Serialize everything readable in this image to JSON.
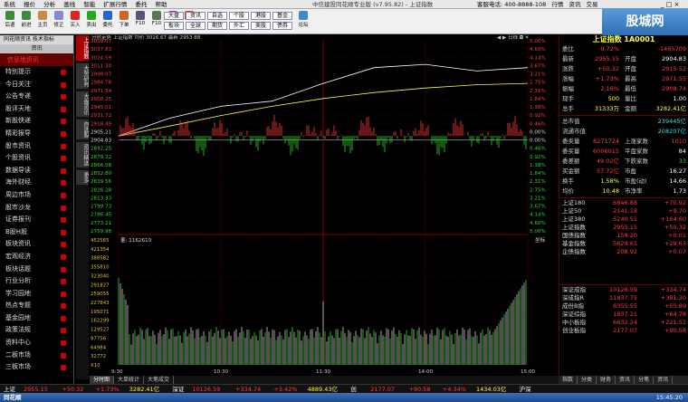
{
  "titlebar": {
    "menus": [
      "系统",
      "报价",
      "分析",
      "画线",
      "智能",
      "扩展行情",
      "委托",
      "帮助"
    ],
    "caption": "中信建投同花顺专业版 (v7.95.82) - 上证指数",
    "right": [
      "客服电话: 400-8888-108",
      "行情",
      "资讯",
      "交易"
    ],
    "window_controls": "_ □ ×"
  },
  "toolbar": {
    "buttons": [
      "后退",
      "前进",
      "主页",
      "修正",
      "买入",
      "卖出",
      "委托",
      "下单",
      "F10",
      "F10",
      "分时",
      "K线"
    ],
    "boxes": [
      "大盘",
      "资讯",
      "自选",
      "个股",
      "板块",
      "全球",
      "期货",
      "外汇",
      "港股",
      "美股",
      "基金",
      "债券"
    ],
    "extra": [
      "论坛"
    ],
    "ad_text": "股城网"
  },
  "sidebar": {
    "tabs": "同花顺资讯  技术指标",
    "subtab": "资讯",
    "heading": "信息地资讯",
    "items": [
      "特别提示",
      "今日关注",
      "公告专递",
      "股评天地",
      "新股快递",
      "精彩报导",
      "股市资讯",
      "个股资讯",
      "数据导读",
      "海外财经",
      "周边市场",
      "股市沙龙",
      "证券报刊",
      "B股H股",
      "板块资讯",
      "宏观经济",
      "板块话题",
      "行业分析",
      "学习园地",
      "热点专题",
      "基金园地",
      "政策法规",
      "资料中心",
      "二板市场",
      "三板市场"
    ],
    "footer": "信息地资讯"
  },
  "vtabs": [
    "上证指数",
    "大势研判",
    "大盘资讯",
    "自选股",
    "资讯精选",
    "更多"
  ],
  "chart": {
    "header": "分时走势  上证指数  均价 3016.67  最新 2953.88",
    "price_labels_left": [
      "3050.07",
      "3037.83",
      "3024.59",
      "3011.30",
      "2998.07",
      "2984.78",
      "2971.54",
      "2958.25",
      "2945.01",
      "2931.72",
      "2918.49",
      "2905.21",
      "2904.83",
      "2892.25",
      "2879.32",
      "2866.08",
      "2852.80",
      "2839.56",
      "2826.28",
      "2813.33",
      "2799.73",
      "2786.45",
      "2773.21",
      "2759.98"
    ],
    "pct_labels_right": [
      "5.00%",
      "4.60%",
      "4.14%",
      "3.67%",
      "3.21%",
      "2.75%",
      "2.31%",
      "1.84%",
      "1.38%",
      "0.92%",
      "0.46%",
      "0.00%",
      "0.00%",
      "0.46%",
      "0.92%",
      "1.38%",
      "1.84%",
      "2.31%",
      "2.75%",
      "3.21%",
      "3.67%",
      "4.14%",
      "4.60%",
      "5.00%"
    ],
    "vol_header": "量: 1162610",
    "vol_labels_left": [
      "452565",
      "421354",
      "388582",
      "355810",
      "323040",
      "291827",
      "259055",
      "227843",
      "195071",
      "162299",
      "129527",
      "97756",
      "64984",
      "32772",
      "X10"
    ],
    "vol_button": "坐标",
    "time_labels": [
      "9:30",
      "10:30",
      "11:30",
      "14:00",
      "15:00"
    ],
    "top_right_icons": "◀ ▶  日线  ◘ ✕"
  },
  "chart_data": {
    "type": "line",
    "x": [
      "9:30",
      "10:00",
      "10:30",
      "11:00",
      "11:30",
      "13:30",
      "14:00",
      "14:30",
      "15:00"
    ],
    "series": [
      {
        "name": "最新",
        "values": [
          2904.83,
          2932,
          2950,
          2958,
          2985,
          3009,
          3014,
          3004,
          3009
        ]
      },
      {
        "name": "均价",
        "values": [
          2904.83,
          2920,
          2936,
          2950,
          2962,
          2971,
          2978,
          2983,
          2985
        ]
      }
    ],
    "ylim": [
      2759.98,
      3050.07
    ]
  },
  "rpanel": {
    "title": "上证指数 1A0001",
    "rows": [
      {
        "l1": "委比",
        "v1": "-9.72%",
        "c1": "red",
        "l2": "",
        "v2": "-1465709",
        "c2": "red"
      },
      {
        "l1": "最新",
        "v1": "2955.15",
        "c1": "red",
        "l2": "开盘",
        "v2": "2904.83",
        "c2": "wht"
      },
      {
        "l1": "涨跌",
        "v1": "+50.32",
        "c1": "red",
        "l2": "开盘",
        "v2": "2915.52",
        "c2": "red"
      },
      {
        "l1": "涨幅",
        "v1": "+1.73%",
        "c1": "red",
        "l2": "最高",
        "v2": "2971.55",
        "c2": "red"
      },
      {
        "l1": "振幅",
        "v1": "2.16%",
        "c1": "red",
        "l2": "最低",
        "v2": "2908.74",
        "c2": "red"
      },
      {
        "l1": "现手",
        "v1": "500",
        "c1": "yel",
        "l2": "量比",
        "v2": "1.00",
        "c2": "wht"
      },
      {
        "l1": "总手",
        "v1": "31333万",
        "c1": "yel",
        "l2": "金额",
        "v2": "3282.41亿",
        "c2": "yel"
      }
    ],
    "rows2": [
      {
        "l1": "总市值",
        "v1": "",
        "c1": "wht",
        "l2": "",
        "v2": "239445亿",
        "c2": "cyn"
      },
      {
        "l1": "流通市值",
        "v1": "",
        "c1": "wht",
        "l2": "",
        "v2": "208207亿",
        "c2": "cyn"
      },
      {
        "l1": "委卖量",
        "v1": "8271724",
        "c1": "red",
        "l2": "上涨家数",
        "v2": "1010",
        "c2": "red"
      },
      {
        "l1": "委买量",
        "v1": "6006015",
        "c1": "red",
        "l2": "平盘家数",
        "v2": "84",
        "c2": "wht"
      },
      {
        "l1": "委差额",
        "v1": "49.02亿",
        "c1": "red",
        "l2": "下跌家数",
        "v2": "33",
        "c2": "grn"
      },
      {
        "l1": "买金额",
        "v1": "57.72亿",
        "c1": "red",
        "l2": "市盈",
        "v2": "16.27",
        "c2": "wht"
      },
      {
        "l1": "换手",
        "v1": "1.58%",
        "c1": "yel",
        "l2": "市盈(动)",
        "v2": "14.66",
        "c2": "wht"
      },
      {
        "l1": "均价",
        "v1": "10.48",
        "c1": "yel",
        "l2": "市净率",
        "v2": "1.73",
        "c2": "wht"
      }
    ],
    "indices1": [
      {
        "n": "上证180",
        "a": "6846.88",
        "b": "+70.92"
      },
      {
        "n": "上证50",
        "a": "2141.18",
        "b": "+9.70"
      },
      {
        "n": "上证380",
        "a": "5240.51",
        "b": "+164.60"
      },
      {
        "n": "上证指数",
        "a": "2955.15",
        "b": "+50.32"
      },
      {
        "n": "国债指数",
        "a": "158.20",
        "b": "+0.01"
      },
      {
        "n": "基金指数",
        "a": "5629.61",
        "b": "+29.63"
      },
      {
        "n": "企债指数",
        "a": "208.92",
        "b": "+0.07"
      }
    ],
    "indices2": [
      {
        "n": "深证成指",
        "a": "10126.59",
        "b": "+334.74"
      },
      {
        "n": "深成指R",
        "a": "11837.75",
        "b": "+391.30"
      },
      {
        "n": "成份B指",
        "a": "6355.55",
        "b": "+55.89"
      },
      {
        "n": "深证综指",
        "a": "1837.21",
        "b": "+64.78"
      },
      {
        "n": "中小板指",
        "a": "6632.24",
        "b": "+221.51"
      },
      {
        "n": "创业板指",
        "a": "2177.07",
        "b": "+90.58"
      }
    ],
    "tabs": [
      "指数",
      "分类",
      "财务",
      "资讯",
      "分笔",
      "资讯"
    ]
  },
  "bottom_tabs": [
    "分时图",
    "大单统计",
    "大笔成交"
  ],
  "status": {
    "items": [
      {
        "t": "上证",
        "c": "wht"
      },
      {
        "t": "2955.15",
        "c": "red"
      },
      {
        "t": "+50.32",
        "c": "red"
      },
      {
        "t": "+1.73%",
        "c": "red"
      },
      {
        "t": "3282.41亿",
        "c": "yel"
      },
      {
        "t": "深证",
        "c": "wht"
      },
      {
        "t": "10126.59",
        "c": "red"
      },
      {
        "t": "+334.74",
        "c": "red"
      },
      {
        "t": "+3.42%",
        "c": "red"
      },
      {
        "t": "4889.43亿",
        "c": "yel"
      },
      {
        "t": "创",
        "c": "wht"
      },
      {
        "t": "2177.07",
        "c": "red"
      },
      {
        "t": "+90.58",
        "c": "red"
      },
      {
        "t": "+4.34%",
        "c": "red"
      },
      {
        "t": "1434.03亿",
        "c": "yel"
      },
      {
        "t": "沪深",
        "c": "wht"
      }
    ]
  },
  "taskbar": {
    "start": "同花顺",
    "clock": "15:45:20"
  }
}
